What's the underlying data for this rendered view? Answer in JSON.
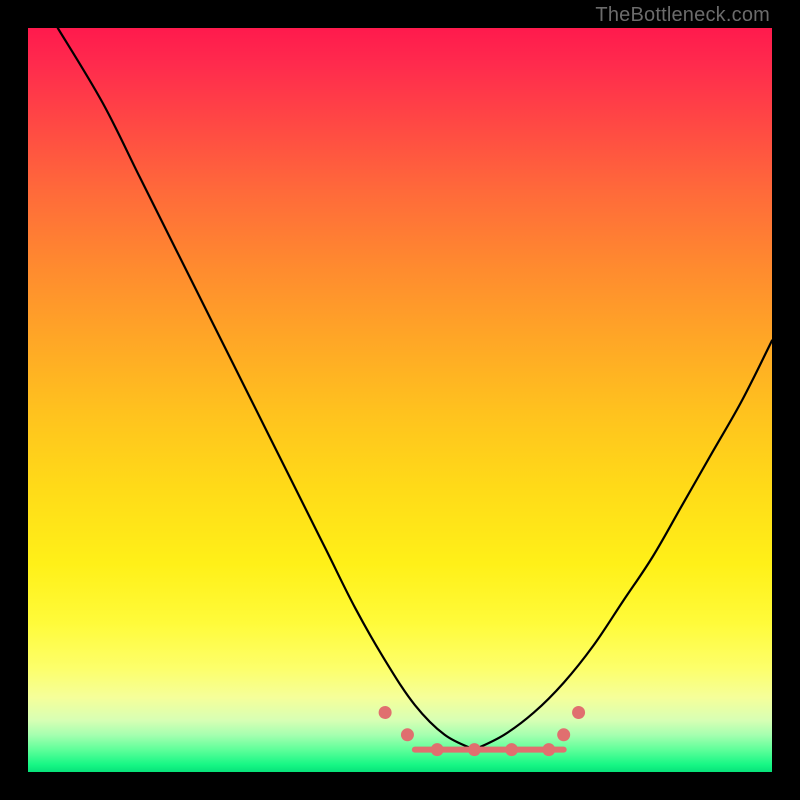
{
  "watermark": "TheBottleneck.com",
  "chart_data": {
    "type": "line",
    "title": "",
    "xlabel": "",
    "ylabel": "",
    "xlim": [
      0,
      100
    ],
    "ylim": [
      0,
      100
    ],
    "grid": false,
    "legend": false,
    "series": [
      {
        "name": "left-curve",
        "x": [
          4,
          10,
          15,
          20,
          25,
          30,
          35,
          40,
          44,
          48,
          52,
          56,
          60
        ],
        "values": [
          100,
          90,
          80,
          70,
          60,
          50,
          40,
          30,
          22,
          15,
          9,
          5,
          3
        ]
      },
      {
        "name": "right-curve",
        "x": [
          60,
          64,
          68,
          72,
          76,
          80,
          84,
          88,
          92,
          96,
          100
        ],
        "values": [
          3,
          5,
          8,
          12,
          17,
          23,
          29,
          36,
          43,
          50,
          58
        ]
      },
      {
        "name": "valley-floor",
        "x": [
          52,
          72
        ],
        "values": [
          3,
          3
        ]
      }
    ],
    "markers": {
      "name": "valley-markers",
      "x": [
        48,
        51,
        55,
        60,
        65,
        70,
        72,
        74
      ],
      "values": [
        8,
        5,
        3,
        3,
        3,
        3,
        5,
        8
      ]
    },
    "background_gradient": {
      "stops": [
        {
          "pos": 0.0,
          "color": "#ff1a4d"
        },
        {
          "pos": 0.5,
          "color": "#ffc31e"
        },
        {
          "pos": 0.86,
          "color": "#fdff6a"
        },
        {
          "pos": 1.0,
          "color": "#07e27a"
        }
      ]
    }
  }
}
